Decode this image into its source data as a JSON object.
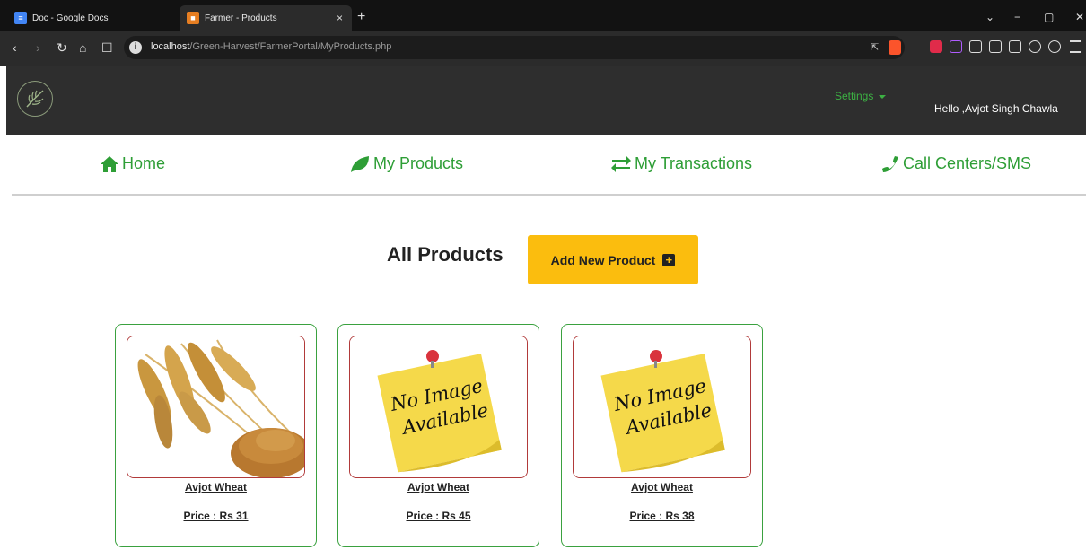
{
  "browser": {
    "tabs": [
      {
        "label": "Doc - Google Docs"
      },
      {
        "label": "Farmer - Products"
      }
    ],
    "new_tab": "+",
    "tab_close": "×",
    "window_controls": [
      "⌄",
      "−",
      "▢",
      "✕"
    ],
    "url_host": "localhost",
    "url_path": "/Green-Harvest/FarmerPortal/MyProducts.php"
  },
  "header": {
    "settings_label": "Settings",
    "greeting": "Hello ,Avjot Singh Chawla"
  },
  "nav": {
    "items": [
      {
        "label": "Home",
        "icon": "home-icon"
      },
      {
        "label": "My Products",
        "icon": "leaf-icon"
      },
      {
        "label": "My Transactions",
        "icon": "exchange-icon"
      },
      {
        "label": "Call Centers/SMS",
        "icon": "phone-icon"
      }
    ]
  },
  "main": {
    "title": "All Products",
    "add_button_label": "Add New Product",
    "add_button_icon": "+",
    "products": [
      {
        "name": "Avjot Wheat",
        "price": "Price : Rs 31",
        "image": "wheat"
      },
      {
        "name": "Avjot Wheat",
        "price": "Price : Rs 45",
        "image": "no-image"
      },
      {
        "name": "Avjot Wheat",
        "price": "Price : Rs 38",
        "image": "no-image"
      }
    ],
    "no_image_line1": "No Image",
    "no_image_line2": "Available"
  },
  "colors": {
    "accent_green": "#2e9e36",
    "button_yellow": "#fbbd0e",
    "header_dark": "#2e2e2e",
    "card_border": "#3aa13f",
    "image_border": "#b13a3a"
  }
}
